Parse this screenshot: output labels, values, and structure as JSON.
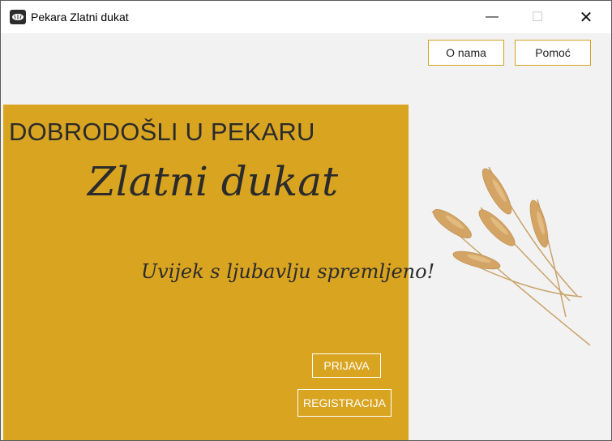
{
  "window": {
    "title": "Pekara Zlatni dukat",
    "controls": {
      "minimize": "—",
      "maximize": "☐",
      "close": "✕"
    }
  },
  "header": {
    "about_label": "O nama",
    "help_label": "Pomoć"
  },
  "hero": {
    "welcome_text": "DOBRODOŠLI U PEKARU",
    "bakery_name": "Zlatni dukat",
    "slogan": "Uvijek s ljubavlju spremljeno!",
    "login_label": "PRIJAVA",
    "register_label": "REGISTRACIJA"
  },
  "icons": {
    "app": "bread-icon",
    "decoration": "wheat-icon"
  },
  "colors": {
    "accent": "#d9a521",
    "panel_text": "#2b2b2b",
    "background": "#f2f2f2"
  }
}
